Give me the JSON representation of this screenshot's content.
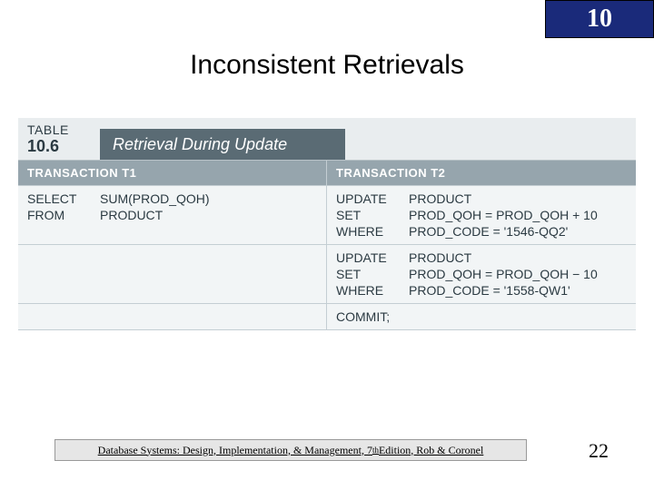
{
  "chapter": "10",
  "title": "Inconsistent Retrievals",
  "table": {
    "label": "TABLE",
    "number": "10.6",
    "caption": "Retrieval During Update",
    "headers": {
      "t1": "TRANSACTION T1",
      "t2": "TRANSACTION T2"
    },
    "row1": {
      "t1": [
        {
          "kw": "SELECT",
          "arg": "SUM(PROD_QOH)"
        },
        {
          "kw": "FROM",
          "arg": "PRODUCT"
        }
      ],
      "t2": [
        {
          "kw": "UPDATE",
          "arg": "PRODUCT"
        },
        {
          "kw": "SET",
          "arg": "PROD_QOH = PROD_QOH + 10"
        },
        {
          "kw": "WHERE",
          "arg": "PROD_CODE = '1546-QQ2'"
        }
      ]
    },
    "row2": {
      "t1": "",
      "t2": [
        {
          "kw": "UPDATE",
          "arg": "PRODUCT"
        },
        {
          "kw": "SET",
          "arg": "PROD_QOH = PROD_QOH − 10"
        },
        {
          "kw": "WHERE",
          "arg": "PROD_CODE = '1558-QW1'"
        }
      ]
    },
    "row3": {
      "t1": "",
      "t2": "COMMIT;"
    }
  },
  "footer": {
    "pre": "Database Systems: Design, Implementation, & Management, 7",
    "sup": "th",
    "post": " Edition, Rob & Coronel"
  },
  "page": "22"
}
